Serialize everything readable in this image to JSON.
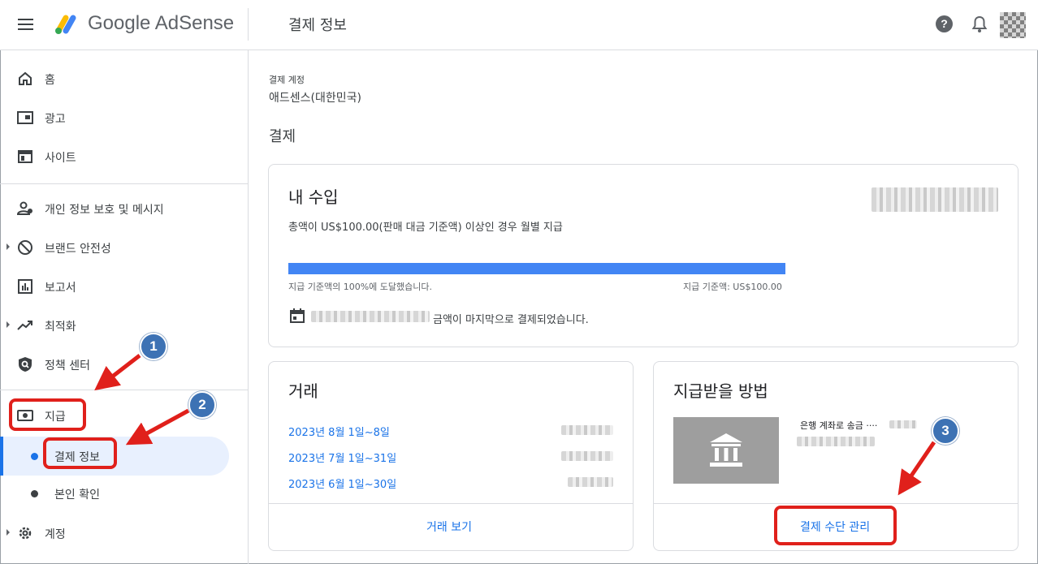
{
  "header": {
    "brand": "Google AdSense",
    "page_title": "결제 정보",
    "help_glyph": "?"
  },
  "sidebar": {
    "items": [
      {
        "label": "홈",
        "icon": "home-icon"
      },
      {
        "label": "광고",
        "icon": "ads-icon"
      },
      {
        "label": "사이트",
        "icon": "sites-icon"
      },
      {
        "label": "개인 정보 보호 및 메시지",
        "icon": "privacy-icon"
      },
      {
        "label": "브랜드 안전성",
        "icon": "block-icon"
      },
      {
        "label": "보고서",
        "icon": "reports-icon"
      },
      {
        "label": "최적화",
        "icon": "trending-icon"
      },
      {
        "label": "정책 센터",
        "icon": "policy-shield-icon"
      },
      {
        "label": "지급",
        "icon": "payments-icon"
      },
      {
        "label": "계정",
        "icon": "gear-icon"
      }
    ],
    "payments_sub": [
      {
        "label": "결제 정보",
        "active": true
      },
      {
        "label": "본인 확인",
        "active": false
      }
    ]
  },
  "main": {
    "account_label": "결제 계정",
    "account_name": "애드센스(대한민국)",
    "section_title": "결제",
    "earnings": {
      "title": "내 수입",
      "description": "총액이 US$100.00(판매 대금 기준액) 이상인 경우 월별 지급",
      "progress_percent": 100,
      "progress_left": "지급 기준액의 100%에 도달했습니다.",
      "progress_right": "지급 기준액: US$100.00",
      "last_payment_suffix": "금액이 마지막으로 결제되었습니다."
    },
    "transactions": {
      "title": "거래",
      "rows": [
        {
          "period": "2023년 8월 1일~8일"
        },
        {
          "period": "2023년 7월 1일~31일"
        },
        {
          "period": "2023년 6월 1일~30일"
        }
      ],
      "view_button": "거래 보기"
    },
    "payment_method": {
      "title": "지급받을 방법",
      "method": "은행 계좌로 송금 ····",
      "manage_button": "결제 수단 관리"
    }
  },
  "annotations": {
    "badges": [
      "1",
      "2",
      "3"
    ],
    "color": "#e0201b",
    "badge_color": "#3d72b4"
  }
}
